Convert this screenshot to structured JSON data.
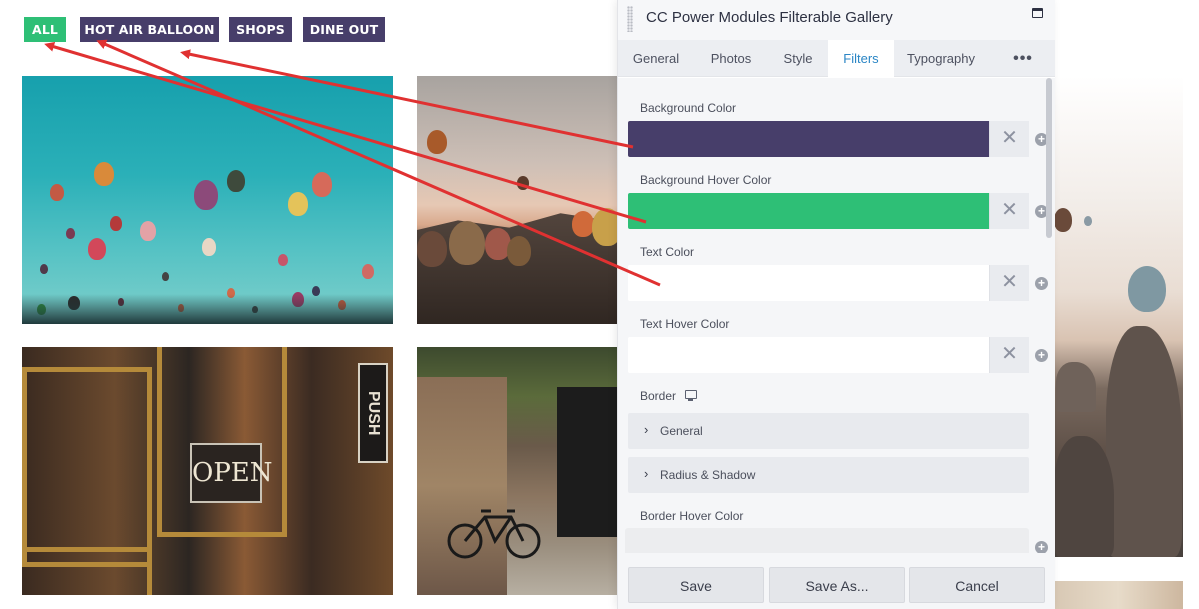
{
  "filters": [
    {
      "label": "ALL",
      "active": true
    },
    {
      "label": "HOT AIR BALLOON",
      "active": false
    },
    {
      "label": "SHOPS",
      "active": false
    },
    {
      "label": "DINE OUT",
      "active": false
    }
  ],
  "colors": {
    "filter_bg": "#473e6a",
    "filter_active_bg": "#2ebf76",
    "active_tab": "#2b86c5",
    "arrow": "#e03131"
  },
  "photos": {
    "shop_sign_open": "OPEN",
    "shop_sign_push": "PUSH"
  },
  "panel": {
    "title": "CC Power Modules Filterable Gallery",
    "tabs": [
      "General",
      "Photos",
      "Style",
      "Filters",
      "Typography"
    ],
    "active_tab": "Filters",
    "more_label": "•••",
    "fields": {
      "bg_color_label": "Background Color",
      "bg_color_value": "#473e6a",
      "bg_hover_label": "Background Hover Color",
      "bg_hover_value": "#2ebf76",
      "text_color_label": "Text Color",
      "text_color_value": "#ffffff",
      "text_hover_label": "Text Hover Color",
      "text_hover_value": "#ffffff",
      "border_label": "Border",
      "border_general": "General",
      "border_radius": "Radius & Shadow",
      "border_hover_label": "Border Hover Color"
    },
    "clear_glyph": "✕",
    "plus_glyph": "+",
    "buttons": {
      "save": "Save",
      "save_as": "Save As...",
      "cancel": "Cancel"
    }
  }
}
